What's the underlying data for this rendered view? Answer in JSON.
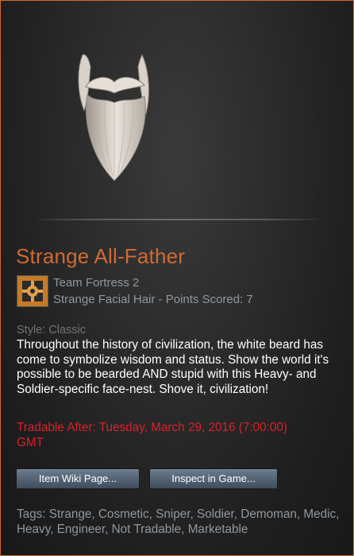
{
  "item": {
    "name": "Strange All-Father",
    "game": "Team Fortress 2",
    "type": "Strange Facial Hair - Points Scored: 7",
    "style": "Style: Classic",
    "description": "Throughout the history of civilization, the white beard has come to symbolize wisdom and status. Show the world it's possible to be bearded AND stupid with this Heavy- and Soldier-specific face-nest. Shove it, civilization!",
    "tradable": "Tradable After: Tuesday, March 29, 2016 (7:00:00) GMT",
    "tags": "Tags: Strange, Cosmetic, Sniper, Soldier, Demoman, Medic, Heavy, Engineer, Not Tradable, Marketable"
  },
  "buttons": {
    "wiki": "Item Wiki Page...",
    "inspect": "Inspect in Game..."
  },
  "colors": {
    "strange": "#cf6a32",
    "tradable_warning": "#d8222a",
    "muted": "#8f98a0"
  },
  "icons": {
    "item": "beard-image",
    "game": "tf2-game-icon"
  }
}
